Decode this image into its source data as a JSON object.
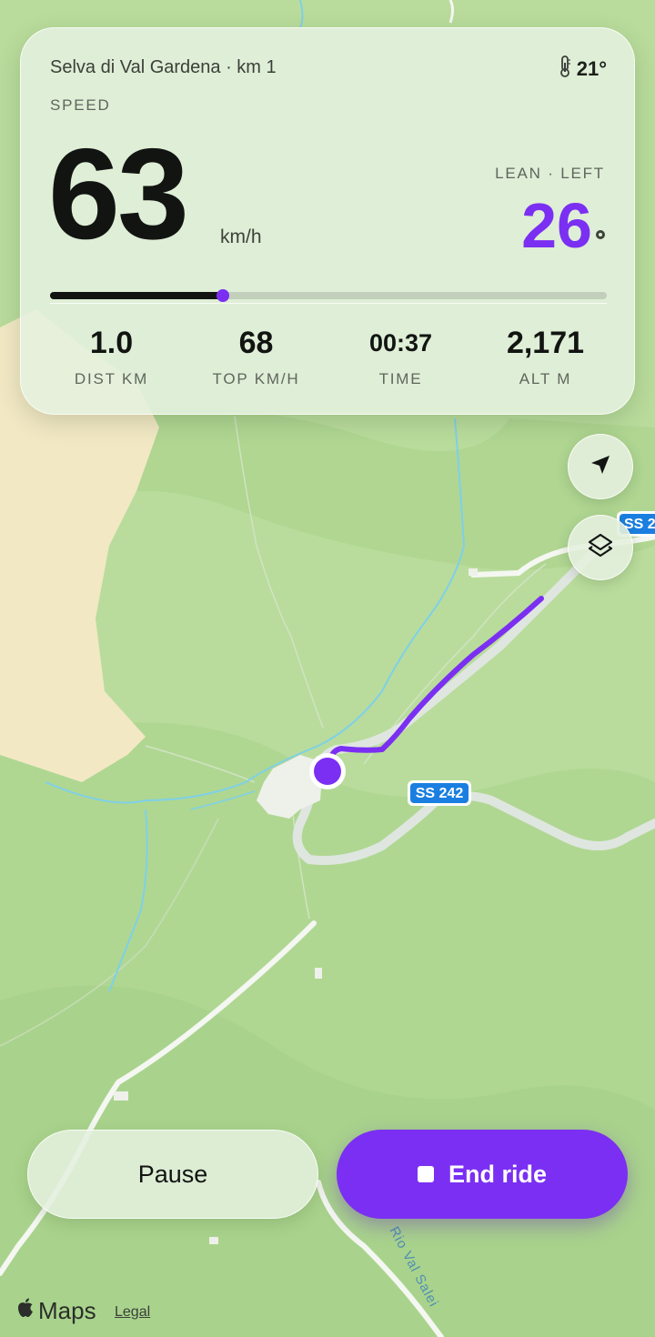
{
  "colors": {
    "accent": "#7b2ff2",
    "map_green": "#b9dc9c",
    "sand": "#f2e8c4",
    "water": "#7fd0e8",
    "road": "#dfe6e0"
  },
  "header": {
    "location": "Selva di Val Gardena · km 1",
    "temperature": "21°",
    "temperature_icon": "thermometer-icon"
  },
  "speed": {
    "label": "SPEED",
    "value": "63",
    "unit": "km/h"
  },
  "lean": {
    "label": "LEAN · LEFT",
    "value": "26"
  },
  "progress": {
    "fraction": 0.31
  },
  "stats": [
    {
      "value": "1.0",
      "label": "DIST KM"
    },
    {
      "value": "68",
      "label": "TOP KM/H"
    },
    {
      "value": "00:37",
      "label": "TIME"
    },
    {
      "value": "2,171",
      "label": "ALT M"
    }
  ],
  "map": {
    "road_label_main": "SS 242",
    "road_label_edge": "SS 2",
    "river_label": "Rio Val Salei",
    "locate_icon": "location-arrow-icon",
    "layers_icon": "layers-icon"
  },
  "controls": {
    "pause_label": "Pause",
    "end_label": "End ride"
  },
  "footer": {
    "maps_label": "Maps",
    "legal_label": "Legal"
  }
}
